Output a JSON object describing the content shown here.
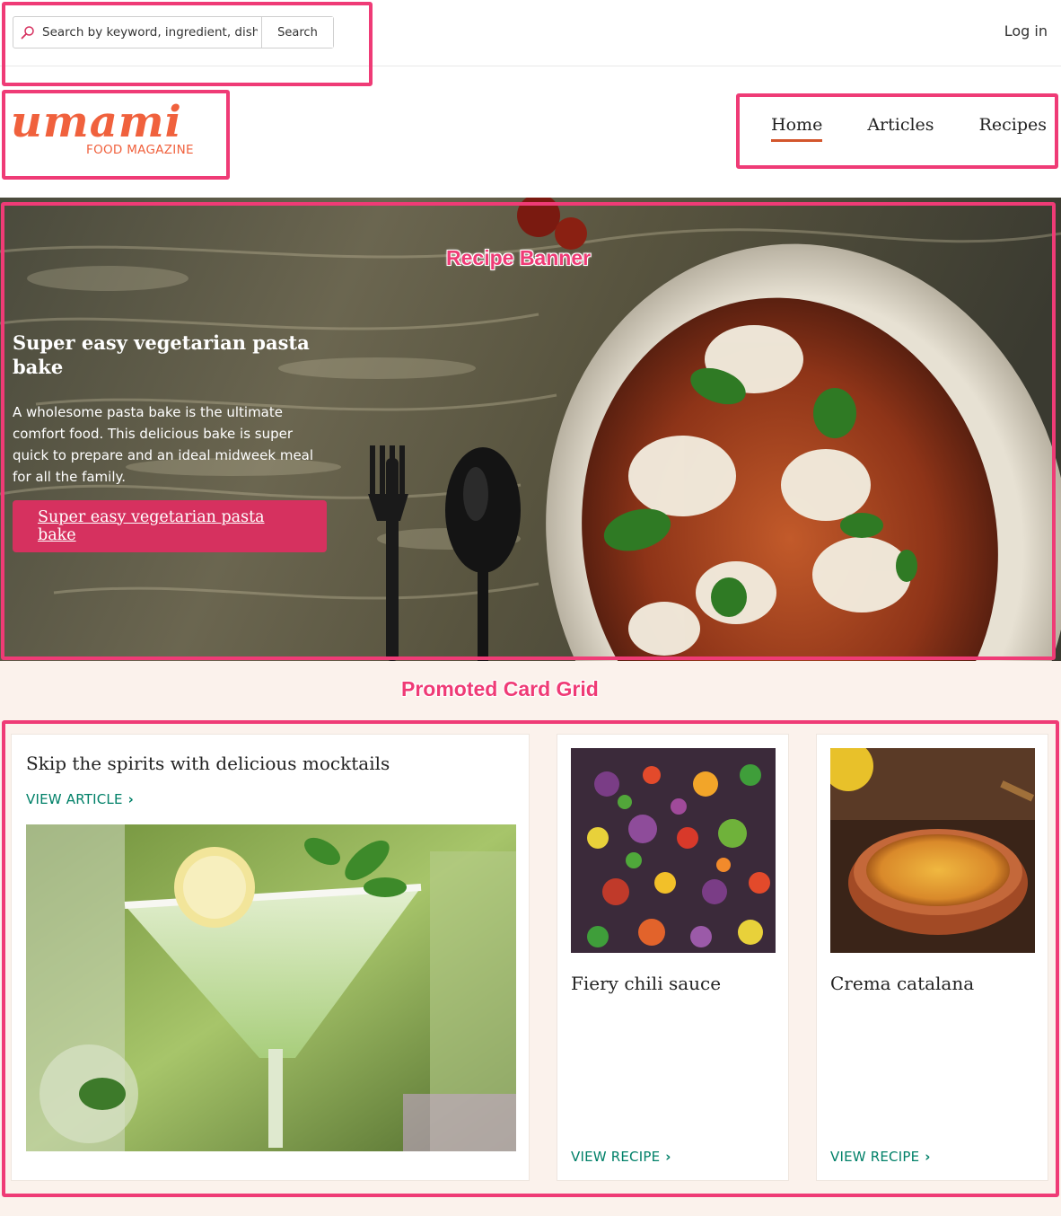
{
  "header": {
    "search_placeholder": "Search by keyword, ingredient, dish",
    "search_button": "Search",
    "login": "Log in"
  },
  "logo": {
    "wordmark": "umami",
    "tagline": "FOOD MAGAZINE"
  },
  "nav": {
    "items": [
      {
        "label": "Home",
        "active": true
      },
      {
        "label": "Articles",
        "active": false
      },
      {
        "label": "Recipes",
        "active": false
      }
    ]
  },
  "banner": {
    "title": "Super easy vegetarian pasta bake",
    "description": "A wholesome pasta bake is the ultimate comfort food. This delicious bake is super quick to prepare and an ideal midweek meal for all the family.",
    "button": "Super easy vegetarian pasta bake"
  },
  "cards": [
    {
      "title": "Skip the spirits with delicious mocktails",
      "link": "VIEW ARTICLE"
    },
    {
      "title": "Fiery chili sauce",
      "link": "VIEW RECIPE"
    },
    {
      "title": "Crema catalana",
      "link": "VIEW RECIPE"
    }
  ],
  "annotations": {
    "banner_label": "Recipe Banner",
    "grid_label": "Promoted Card Grid"
  },
  "colors": {
    "brand": "#f0613d",
    "accent_button": "#d6315f",
    "link_green": "#008068",
    "annotation": "#ef3b76",
    "grid_background": "#fbf2ec"
  },
  "icons": {
    "search": "search-icon",
    "chevron": "chevron-right-icon"
  }
}
